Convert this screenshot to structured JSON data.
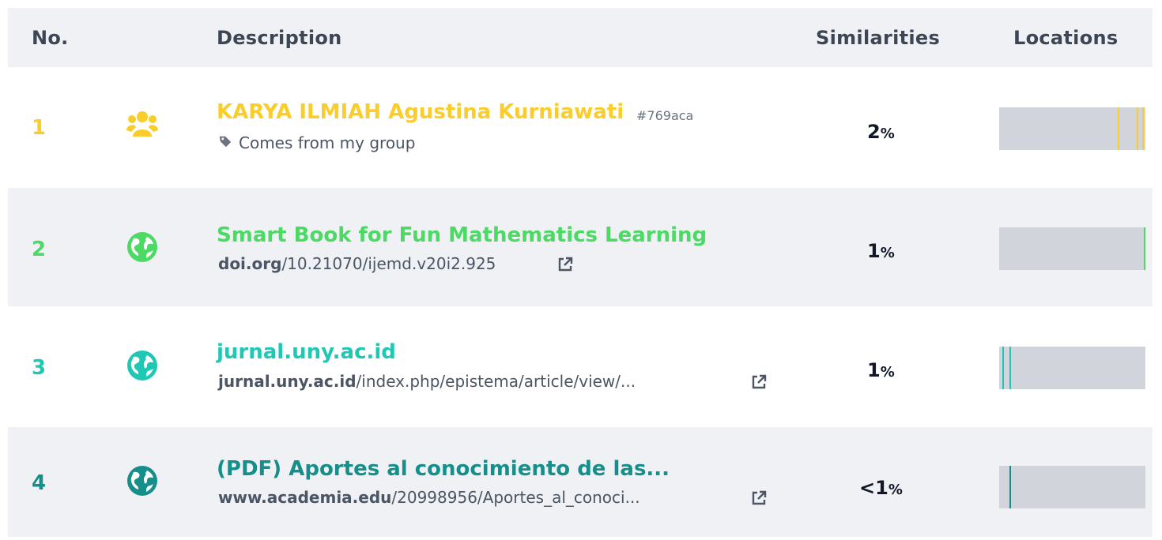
{
  "header": {
    "no": "No.",
    "description": "Description",
    "similarities": "Similarities",
    "locations": "Locations"
  },
  "rows": [
    {
      "number": "1",
      "icon": "group-icon",
      "color": "#fbcd2a",
      "title": "KARYA ILMIAH Agustina Kurniawati",
      "hash": "#769aca",
      "tag_icon": "tag-icon",
      "subtitle": "Comes from my group",
      "percent_value": "2",
      "percent_sign": "%",
      "location_marks": [
        0.81,
        0.94,
        0.98
      ]
    },
    {
      "number": "2",
      "icon": "globe-icon",
      "color": "#4cd964",
      "title": "Smart Book for Fun Mathematics Learning",
      "url_host": "doi.org",
      "url_path": "/10.21070/ijemd.v20i2.925",
      "link_icon": "external-link-icon",
      "percent_value": "1",
      "percent_sign": "%",
      "location_marks": [
        0.99
      ]
    },
    {
      "number": "3",
      "icon": "globe-icon",
      "color": "#1ec8b4",
      "title": "jurnal.uny.ac.id",
      "url_host": "jurnal.uny.ac.id",
      "url_path": "/index.php/epistema/article/view/...",
      "link_icon": "external-link-icon",
      "percent_value": "1",
      "percent_sign": "%",
      "location_marks": [
        0.02,
        0.07
      ]
    },
    {
      "number": "4",
      "icon": "globe-icon",
      "color": "#168f8a",
      "title": "(PDF) Aportes al conocimiento de las...",
      "url_host": "www.academia.edu",
      "url_path": "/20998956/Aportes_al_conoci...",
      "link_icon": "external-link-icon",
      "percent_value": "<1",
      "percent_sign": "%",
      "location_marks": [
        0.07
      ]
    }
  ]
}
